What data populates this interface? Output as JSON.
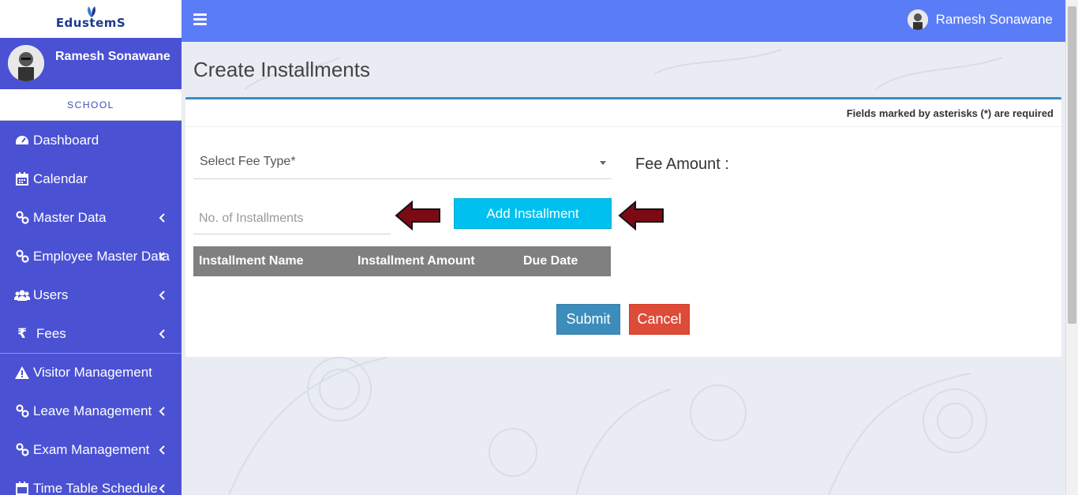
{
  "app": {
    "logo_text": "EdustemS"
  },
  "sidebar": {
    "user_name": "Ramesh Sonawane",
    "role": "SCHOOL",
    "items": [
      {
        "label": "Dashboard",
        "icon": "dashboard-icon",
        "has_chevron": false
      },
      {
        "label": "Calendar",
        "icon": "calendar-icon",
        "has_chevron": false
      },
      {
        "label": "Master Data",
        "icon": "link-icon",
        "has_chevron": true
      },
      {
        "label": "Employee Master Data",
        "icon": "link-icon",
        "has_chevron": true
      },
      {
        "label": "Users",
        "icon": "users-icon",
        "has_chevron": true
      },
      {
        "label": "Fees",
        "icon": "rupee-icon",
        "has_chevron": true
      },
      {
        "label": "Visitor Management",
        "icon": "warning-icon",
        "has_chevron": false
      },
      {
        "label": "Leave Management",
        "icon": "link-icon",
        "has_chevron": true
      },
      {
        "label": "Exam Management",
        "icon": "link-icon",
        "has_chevron": true
      },
      {
        "label": "Time Table Schedule",
        "icon": "calendar-icon",
        "has_chevron": true
      }
    ]
  },
  "topbar": {
    "user_name": "Ramesh Sonawane"
  },
  "main": {
    "page_title": "Create Installments",
    "required_note": "Fields marked by asterisks (*) are required",
    "fee_type_placeholder": "Select Fee Type*",
    "fee_amount_label": "Fee Amount :",
    "installments_placeholder": "No. of Installments",
    "add_installment_label": "Add Installment",
    "table_headers": [
      "Installment Name",
      "Installment Amount",
      "Due Date"
    ],
    "submit_label": "Submit",
    "cancel_label": "Cancel"
  },
  "colors": {
    "sidebar": "#4a51d3",
    "topbar": "#5b7cf7",
    "primary": "#3c8dbc",
    "info": "#00c0ef",
    "danger": "#dd4b39",
    "arrow": "#7b0a14"
  }
}
